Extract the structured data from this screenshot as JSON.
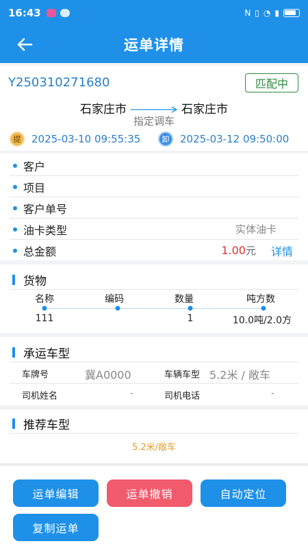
{
  "status_bar": {
    "time": "16:43"
  },
  "header": {
    "title": "运单详情"
  },
  "waybill": {
    "number": "Y250310271680",
    "status": "匹配中",
    "origin": "石家庄市",
    "destination": "石家庄市",
    "dispatch_type": "指定调车",
    "pickup_tag": "提",
    "pickup_time": "2025-03-10 09:55:35",
    "unload_tag": "卸",
    "unload_time": "2025-03-12 09:50:00"
  },
  "info": {
    "customer_label": "客户",
    "project_label": "项目",
    "customer_order_label": "客户单号",
    "oil_card_label": "油卡类型",
    "oil_card_value": "实体油卡",
    "total_label": "总金额",
    "total_value": "1.00",
    "total_unit": "元",
    "detail_link": "详情"
  },
  "goods": {
    "title": "货物",
    "columns": [
      "名称",
      "编码",
      "数量",
      "吨方数"
    ],
    "row": [
      "111",
      "",
      "1",
      "10.0吨/2.0方"
    ]
  },
  "vehicle": {
    "title": "承运车型",
    "plate_label": "车牌号",
    "plate_value": "冀A0000",
    "type_label": "车辆车型",
    "type_value": "5.2米 / 敞车",
    "driver_name_label": "司机姓名",
    "driver_name_value": "-",
    "driver_phone_label": "司机电话",
    "driver_phone_value": "-"
  },
  "recommended": {
    "title": "推荐车型",
    "value": "5.2米/敞车"
  },
  "actions": {
    "edit": "运单编辑",
    "cancel": "运单撤销",
    "locate": "自动定位",
    "copy": "复制运单"
  }
}
